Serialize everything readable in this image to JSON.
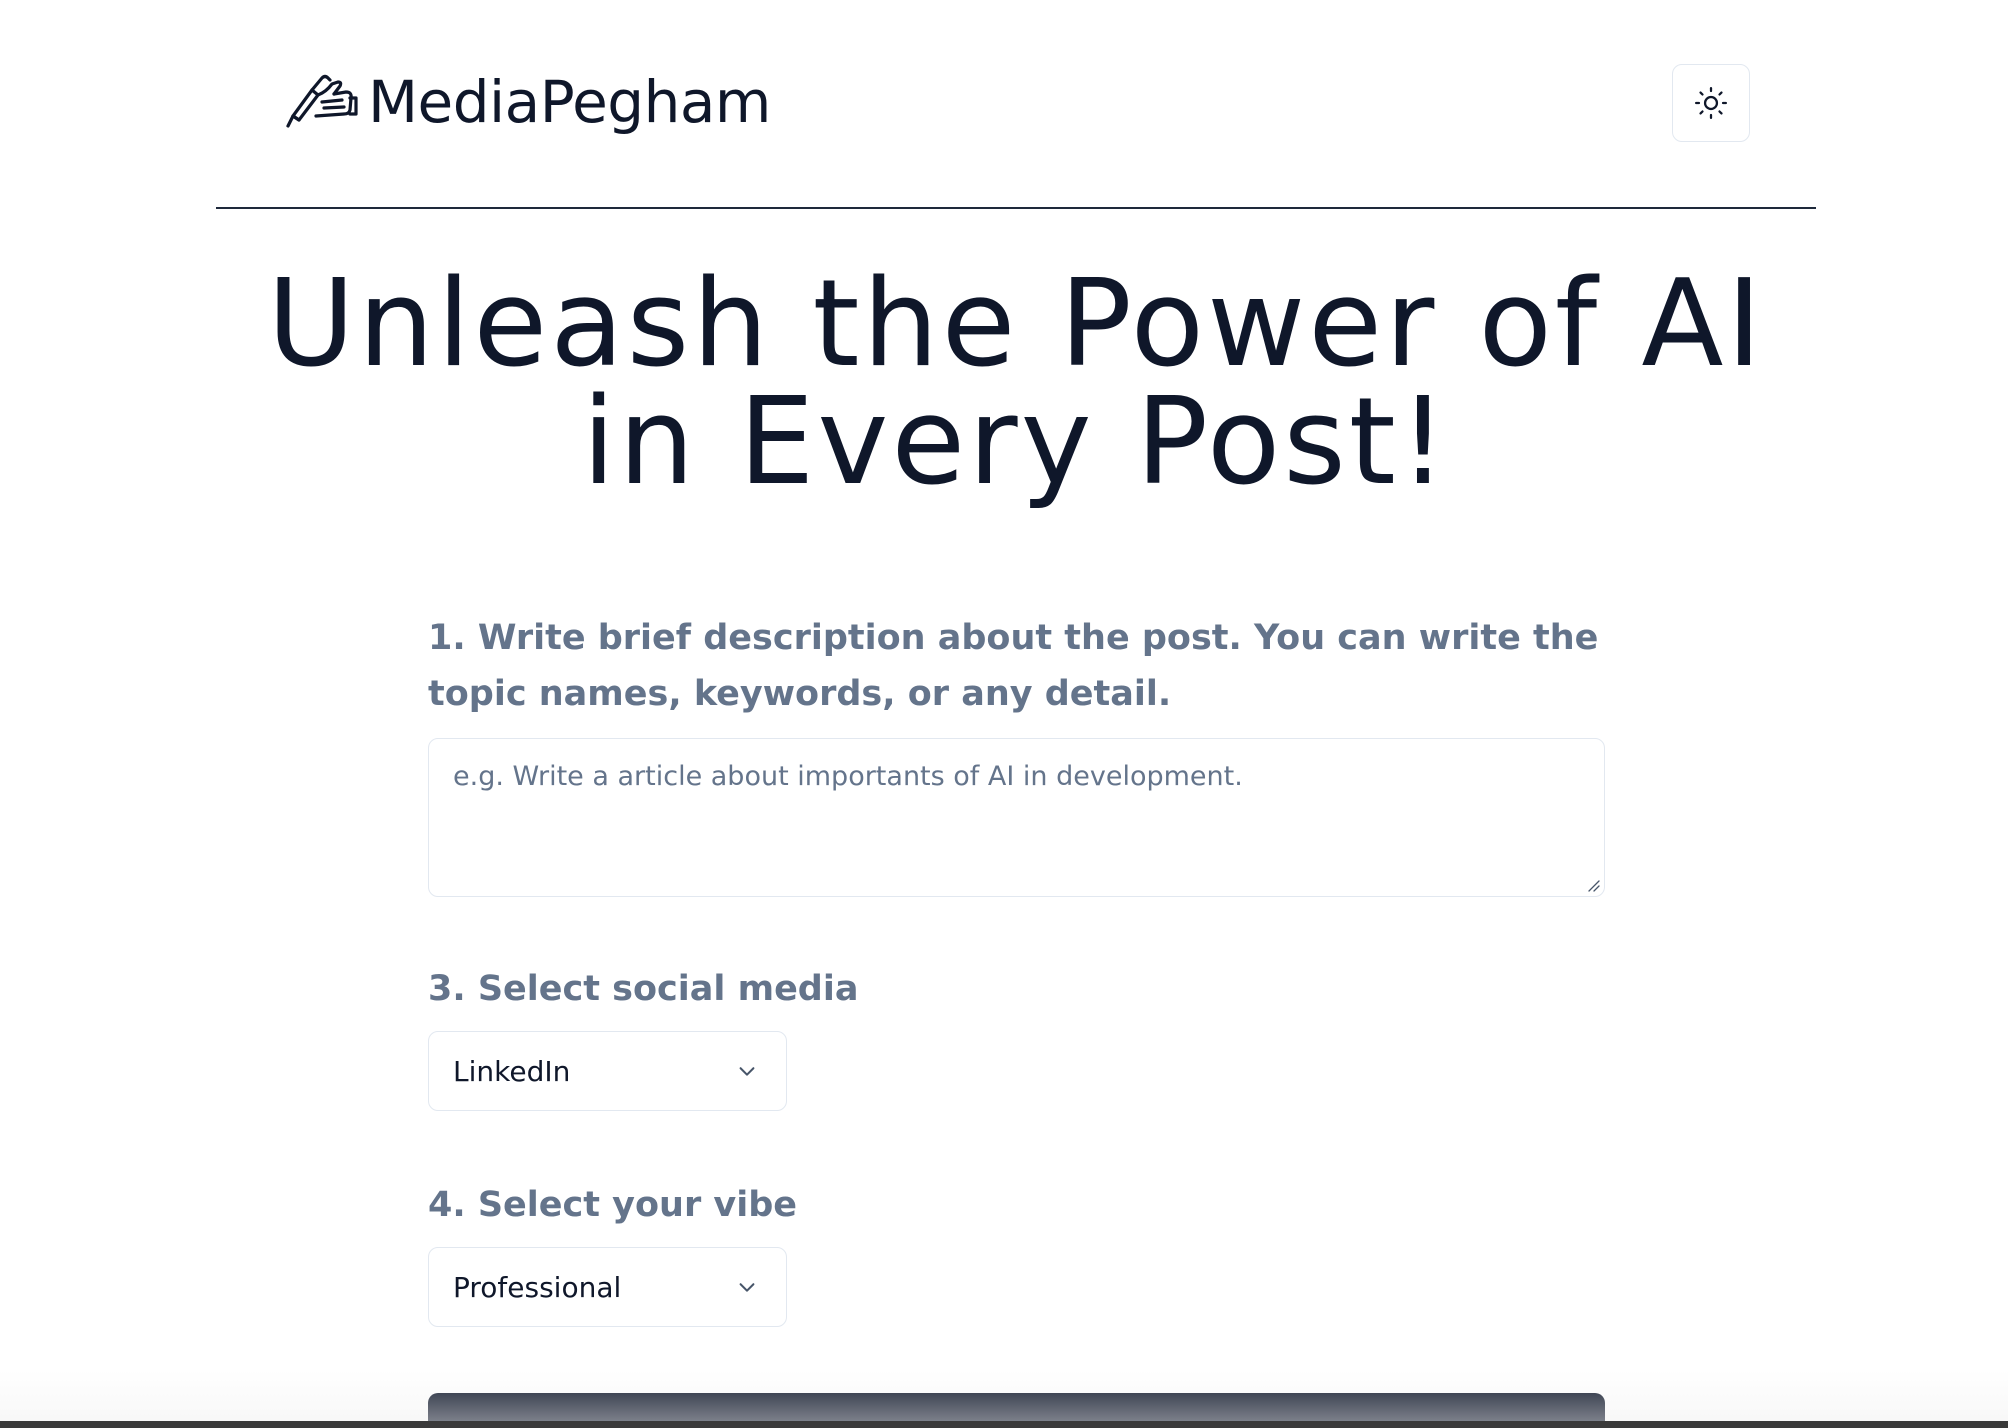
{
  "header": {
    "brand_name": "MediaPegham",
    "logo_icon": "hand-writing-icon",
    "theme_toggle_icon": "sun-icon"
  },
  "hero": {
    "title_line1": "Unleash the Power of AI",
    "title_line2": "in Every Post!"
  },
  "form": {
    "description": {
      "label": "1. Write brief description about the post. You can write the topic names, keywords, or any detail.",
      "value": "",
      "placeholder": "e.g. Write a article about importants of AI in development."
    },
    "social_media": {
      "label": "3. Select social media",
      "selected": "LinkedIn"
    },
    "vibe": {
      "label": "4. Select your vibe",
      "selected": "Professional"
    },
    "submit_label": ""
  },
  "colors": {
    "text_primary": "#0f172a",
    "label_muted": "#64748b",
    "border": "#e2e8f0",
    "button_bg": "#0f172a"
  }
}
